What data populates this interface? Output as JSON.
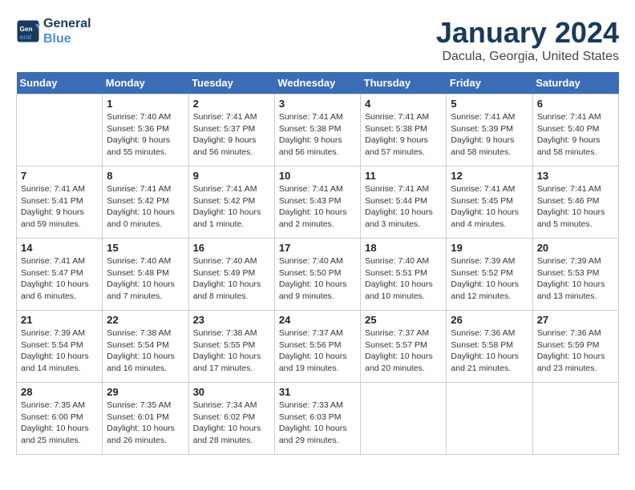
{
  "header": {
    "logo_line1": "General",
    "logo_line2": "Blue",
    "title": "January 2024",
    "subtitle": "Dacula, Georgia, United States"
  },
  "days_of_week": [
    "Sunday",
    "Monday",
    "Tuesday",
    "Wednesday",
    "Thursday",
    "Friday",
    "Saturday"
  ],
  "weeks": [
    [
      {
        "day": "",
        "info": ""
      },
      {
        "day": "1",
        "info": "Sunrise: 7:40 AM\nSunset: 5:36 PM\nDaylight: 9 hours\nand 55 minutes."
      },
      {
        "day": "2",
        "info": "Sunrise: 7:41 AM\nSunset: 5:37 PM\nDaylight: 9 hours\nand 56 minutes."
      },
      {
        "day": "3",
        "info": "Sunrise: 7:41 AM\nSunset: 5:38 PM\nDaylight: 9 hours\nand 56 minutes."
      },
      {
        "day": "4",
        "info": "Sunrise: 7:41 AM\nSunset: 5:38 PM\nDaylight: 9 hours\nand 57 minutes."
      },
      {
        "day": "5",
        "info": "Sunrise: 7:41 AM\nSunset: 5:39 PM\nDaylight: 9 hours\nand 58 minutes."
      },
      {
        "day": "6",
        "info": "Sunrise: 7:41 AM\nSunset: 5:40 PM\nDaylight: 9 hours\nand 58 minutes."
      }
    ],
    [
      {
        "day": "7",
        "info": "Sunrise: 7:41 AM\nSunset: 5:41 PM\nDaylight: 9 hours\nand 59 minutes."
      },
      {
        "day": "8",
        "info": "Sunrise: 7:41 AM\nSunset: 5:42 PM\nDaylight: 10 hours\nand 0 minutes."
      },
      {
        "day": "9",
        "info": "Sunrise: 7:41 AM\nSunset: 5:42 PM\nDaylight: 10 hours\nand 1 minute."
      },
      {
        "day": "10",
        "info": "Sunrise: 7:41 AM\nSunset: 5:43 PM\nDaylight: 10 hours\nand 2 minutes."
      },
      {
        "day": "11",
        "info": "Sunrise: 7:41 AM\nSunset: 5:44 PM\nDaylight: 10 hours\nand 3 minutes."
      },
      {
        "day": "12",
        "info": "Sunrise: 7:41 AM\nSunset: 5:45 PM\nDaylight: 10 hours\nand 4 minutes."
      },
      {
        "day": "13",
        "info": "Sunrise: 7:41 AM\nSunset: 5:46 PM\nDaylight: 10 hours\nand 5 minutes."
      }
    ],
    [
      {
        "day": "14",
        "info": "Sunrise: 7:41 AM\nSunset: 5:47 PM\nDaylight: 10 hours\nand 6 minutes."
      },
      {
        "day": "15",
        "info": "Sunrise: 7:40 AM\nSunset: 5:48 PM\nDaylight: 10 hours\nand 7 minutes."
      },
      {
        "day": "16",
        "info": "Sunrise: 7:40 AM\nSunset: 5:49 PM\nDaylight: 10 hours\nand 8 minutes."
      },
      {
        "day": "17",
        "info": "Sunrise: 7:40 AM\nSunset: 5:50 PM\nDaylight: 10 hours\nand 9 minutes."
      },
      {
        "day": "18",
        "info": "Sunrise: 7:40 AM\nSunset: 5:51 PM\nDaylight: 10 hours\nand 10 minutes."
      },
      {
        "day": "19",
        "info": "Sunrise: 7:39 AM\nSunset: 5:52 PM\nDaylight: 10 hours\nand 12 minutes."
      },
      {
        "day": "20",
        "info": "Sunrise: 7:39 AM\nSunset: 5:53 PM\nDaylight: 10 hours\nand 13 minutes."
      }
    ],
    [
      {
        "day": "21",
        "info": "Sunrise: 7:39 AM\nSunset: 5:54 PM\nDaylight: 10 hours\nand 14 minutes."
      },
      {
        "day": "22",
        "info": "Sunrise: 7:38 AM\nSunset: 5:54 PM\nDaylight: 10 hours\nand 16 minutes."
      },
      {
        "day": "23",
        "info": "Sunrise: 7:38 AM\nSunset: 5:55 PM\nDaylight: 10 hours\nand 17 minutes."
      },
      {
        "day": "24",
        "info": "Sunrise: 7:37 AM\nSunset: 5:56 PM\nDaylight: 10 hours\nand 19 minutes."
      },
      {
        "day": "25",
        "info": "Sunrise: 7:37 AM\nSunset: 5:57 PM\nDaylight: 10 hours\nand 20 minutes."
      },
      {
        "day": "26",
        "info": "Sunrise: 7:36 AM\nSunset: 5:58 PM\nDaylight: 10 hours\nand 21 minutes."
      },
      {
        "day": "27",
        "info": "Sunrise: 7:36 AM\nSunset: 5:59 PM\nDaylight: 10 hours\nand 23 minutes."
      }
    ],
    [
      {
        "day": "28",
        "info": "Sunrise: 7:35 AM\nSunset: 6:00 PM\nDaylight: 10 hours\nand 25 minutes."
      },
      {
        "day": "29",
        "info": "Sunrise: 7:35 AM\nSunset: 6:01 PM\nDaylight: 10 hours\nand 26 minutes."
      },
      {
        "day": "30",
        "info": "Sunrise: 7:34 AM\nSunset: 6:02 PM\nDaylight: 10 hours\nand 28 minutes."
      },
      {
        "day": "31",
        "info": "Sunrise: 7:33 AM\nSunset: 6:03 PM\nDaylight: 10 hours\nand 29 minutes."
      },
      {
        "day": "",
        "info": ""
      },
      {
        "day": "",
        "info": ""
      },
      {
        "day": "",
        "info": ""
      }
    ]
  ]
}
